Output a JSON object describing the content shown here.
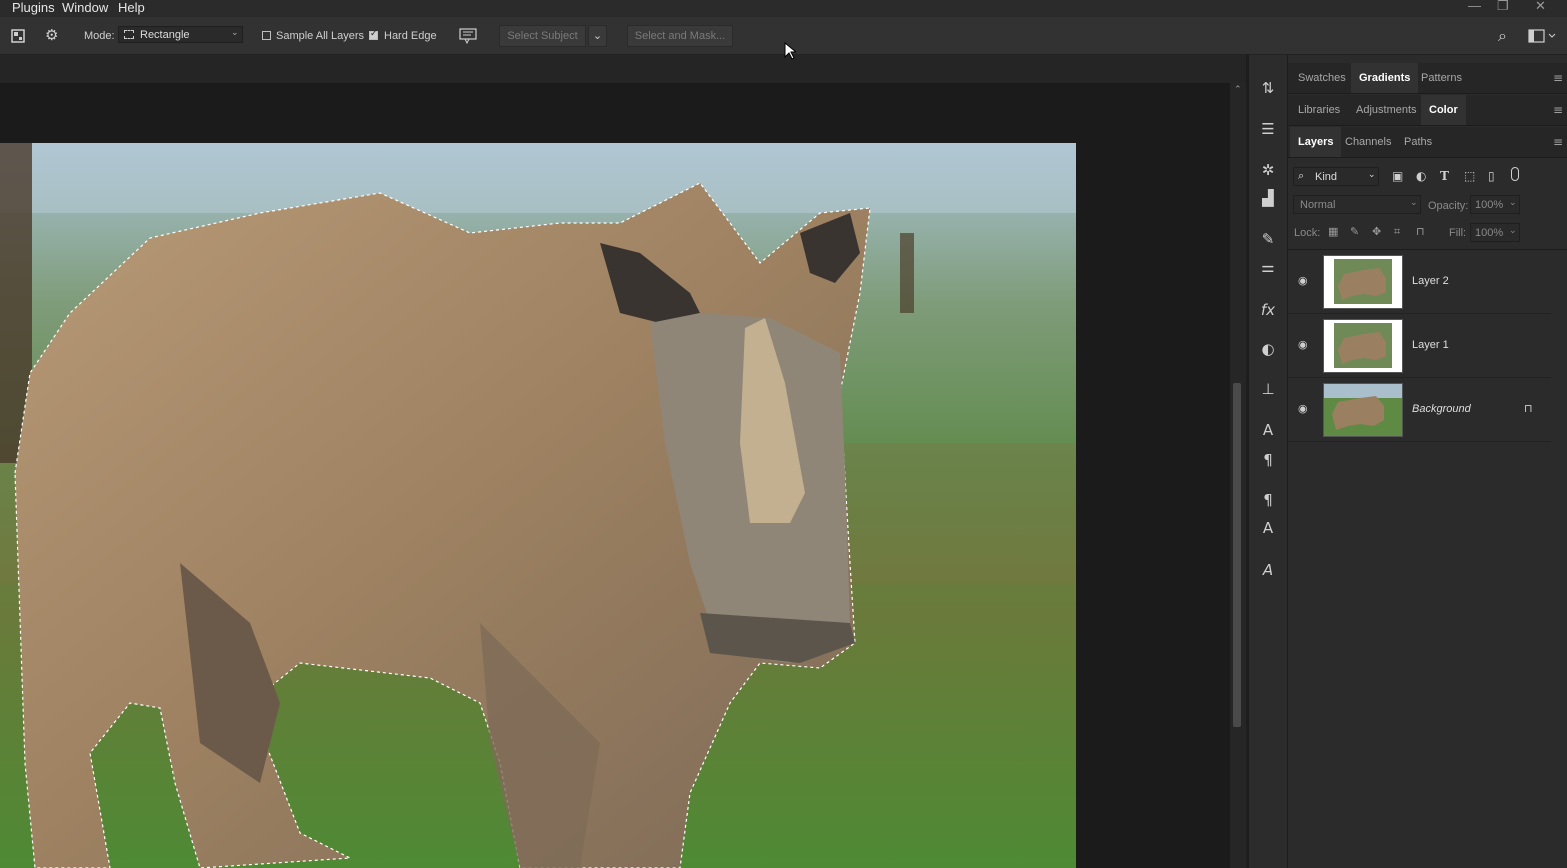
{
  "menu": {
    "items": [
      "Plugins",
      "Window",
      "Help"
    ]
  },
  "options": {
    "mode_label": "Mode:",
    "mode_value": "Rectangle",
    "sample_all_layers": "Sample All Layers",
    "sample_all_checked": false,
    "hard_edge": "Hard Edge",
    "hard_edge_checked": true,
    "select_subject": "Select Subject",
    "select_and_mask": "Select and Mask..."
  },
  "panels": {
    "row1": {
      "tabs": [
        "Swatches",
        "Gradients",
        "Patterns"
      ],
      "active": "Gradients"
    },
    "row2": {
      "tabs": [
        "Libraries",
        "Adjustments",
        "Color"
      ],
      "active": "Color"
    },
    "row3": {
      "tabs": [
        "Layers",
        "Channels",
        "Paths"
      ],
      "active": "Layers"
    }
  },
  "layers_panel": {
    "filter": "Kind",
    "blend_mode": "Normal",
    "opacity_label": "Opacity:",
    "opacity_value": "100%",
    "lock_label": "Lock:",
    "fill_label": "Fill:",
    "fill_value": "100%",
    "layers": [
      {
        "name": "Layer 2",
        "visible": true,
        "locked": false
      },
      {
        "name": "Layer 1",
        "visible": true,
        "locked": false
      },
      {
        "name": "Background",
        "visible": true,
        "locked": true
      }
    ]
  },
  "icons": {
    "menu_icon": "≡",
    "eye_icon": "●",
    "lock_icon": "🔒",
    "search_icon": "⌕"
  },
  "colors": {
    "ui_bg": "#2b2b2b",
    "canvas_bg": "#1b1b1b",
    "active_tab": "#323232"
  }
}
